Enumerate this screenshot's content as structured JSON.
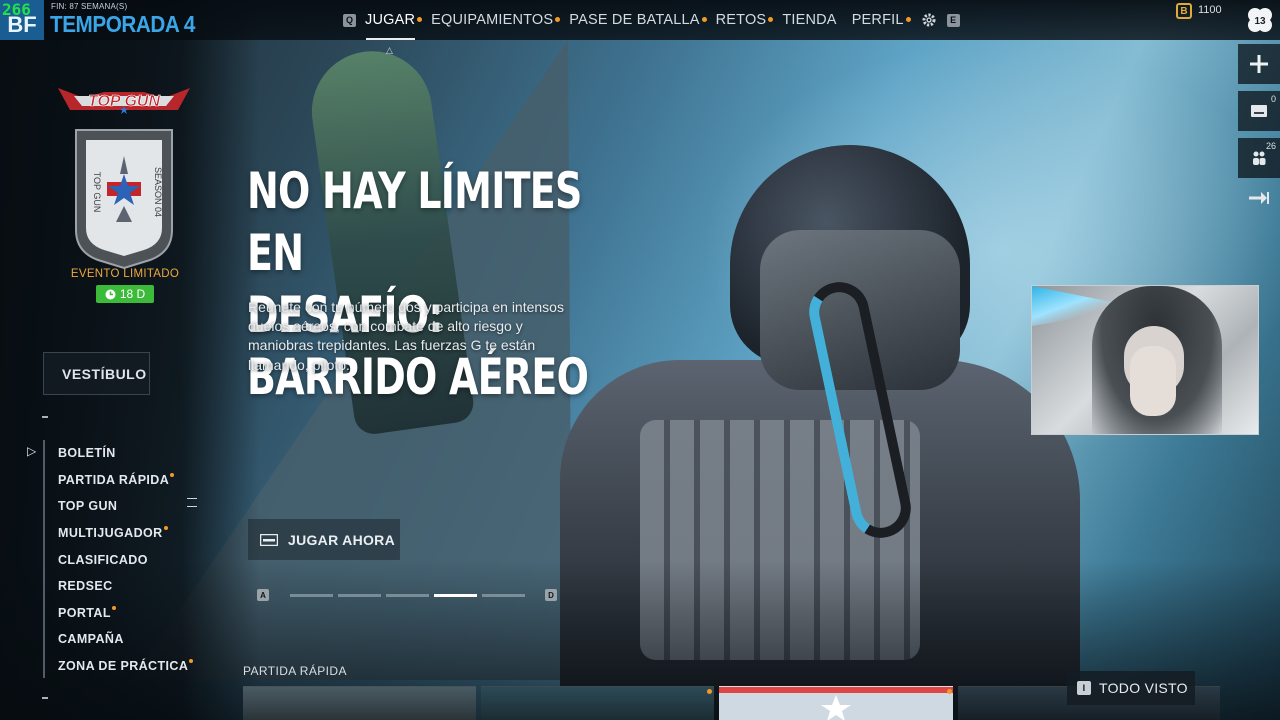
{
  "overlay": {
    "fps": "266"
  },
  "header": {
    "logo_text": "BF",
    "season_subtitle": "FIN: 87 SEMANA(S)",
    "season_title": "TEMPORADA 4",
    "nav_left_key": "Q",
    "nav_right_key": "E",
    "tabs": [
      {
        "label": "JUGAR",
        "dot": true,
        "active": true
      },
      {
        "label": "EQUIPAMIENTOS",
        "dot": true,
        "active": false
      },
      {
        "label": "PASE DE BATALLA",
        "dot": true,
        "active": false
      },
      {
        "label": "RETOS",
        "dot": true,
        "active": false
      },
      {
        "label": "TIENDA",
        "dot": false,
        "active": false
      },
      {
        "label": "PERFIL",
        "dot": true,
        "active": false
      }
    ],
    "currency_icon": "B",
    "currency_value": "1100",
    "level": "13"
  },
  "right_rail": {
    "add_icon": "plus-icon",
    "mail_count": "0",
    "squad_count": "26",
    "exit_icon": "exit-icon"
  },
  "event": {
    "badge_title": "TOP GUN",
    "badge_side_left": "TOP GUN",
    "badge_side_right": "SEASON 04",
    "label": "EVENTO LIMITADO",
    "timer": "18 D"
  },
  "sidebar": {
    "header": "VESTÍBULO",
    "items": [
      {
        "label": "BOLETÍN",
        "dot": false
      },
      {
        "label": "PARTIDA RÁPIDA",
        "dot": true
      },
      {
        "label": "TOP GUN",
        "dot": false
      },
      {
        "label": "MULTIJUGADOR",
        "dot": true
      },
      {
        "label": "CLASIFICADO",
        "dot": false
      },
      {
        "label": "REDSEC",
        "dot": false
      },
      {
        "label": "PORTAL",
        "dot": true
      },
      {
        "label": "CAMPAÑA",
        "dot": false
      },
      {
        "label": "ZONA DE PRÁCTICA",
        "dot": true
      }
    ]
  },
  "hero": {
    "title_line1": "NO HAY LÍMITES EN",
    "title_line2": "DESAFÍO: BARRIDO AÉREO",
    "description": "Reúnete con tu número dos y participa en intensos duelos aéreos, con combate de alto riesgo y maniobras trepidantes. Las fuerzas G te están llamando, piloto.",
    "play_label": "JUGAR AHORA",
    "pager_prev_key": "A",
    "pager_next_key": "D",
    "pager_total": 5,
    "pager_active": 4
  },
  "bottom": {
    "section_label": "PARTIDA RÁPIDA",
    "seen_key": "I",
    "seen_label": "TODO VISTO"
  },
  "colors": {
    "accent_blue": "#3aa6e8",
    "notify_orange": "#f39a26",
    "event_orange": "#f0a93a",
    "timer_green": "#3cba3a"
  }
}
